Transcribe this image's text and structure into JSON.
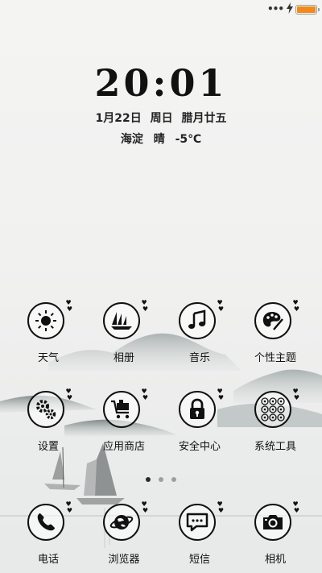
{
  "status_bar": {
    "signal_dots": "•••",
    "battery_level": 1.0,
    "battery_color": "#f08a1c"
  },
  "clock": {
    "time": "20:01"
  },
  "date": {
    "date": "1月22日",
    "weekday": "周日",
    "lunar": "腊月廿五"
  },
  "weather": {
    "location": "海淀",
    "condition": "晴",
    "temperature": "-5℃"
  },
  "pager": {
    "pages": 3,
    "active": 0
  },
  "apps": [
    {
      "label": "天气",
      "icon": "sun-icon"
    },
    {
      "label": "相册",
      "icon": "sailboats-icon"
    },
    {
      "label": "音乐",
      "icon": "music-note-icon"
    },
    {
      "label": "个性主题",
      "icon": "palette-icon"
    },
    {
      "label": "设置",
      "icon": "gears-icon"
    },
    {
      "label": "应用商店",
      "icon": "shopping-cart-icon"
    },
    {
      "label": "安全中心",
      "icon": "lock-icon"
    },
    {
      "label": "系统工具",
      "icon": "tools-grid-icon"
    }
  ],
  "dock": [
    {
      "label": "电话",
      "icon": "phone-icon"
    },
    {
      "label": "浏览器",
      "icon": "globe-icon"
    },
    {
      "label": "短信",
      "icon": "chat-bubble-icon"
    },
    {
      "label": "相机",
      "icon": "camera-icon"
    }
  ]
}
